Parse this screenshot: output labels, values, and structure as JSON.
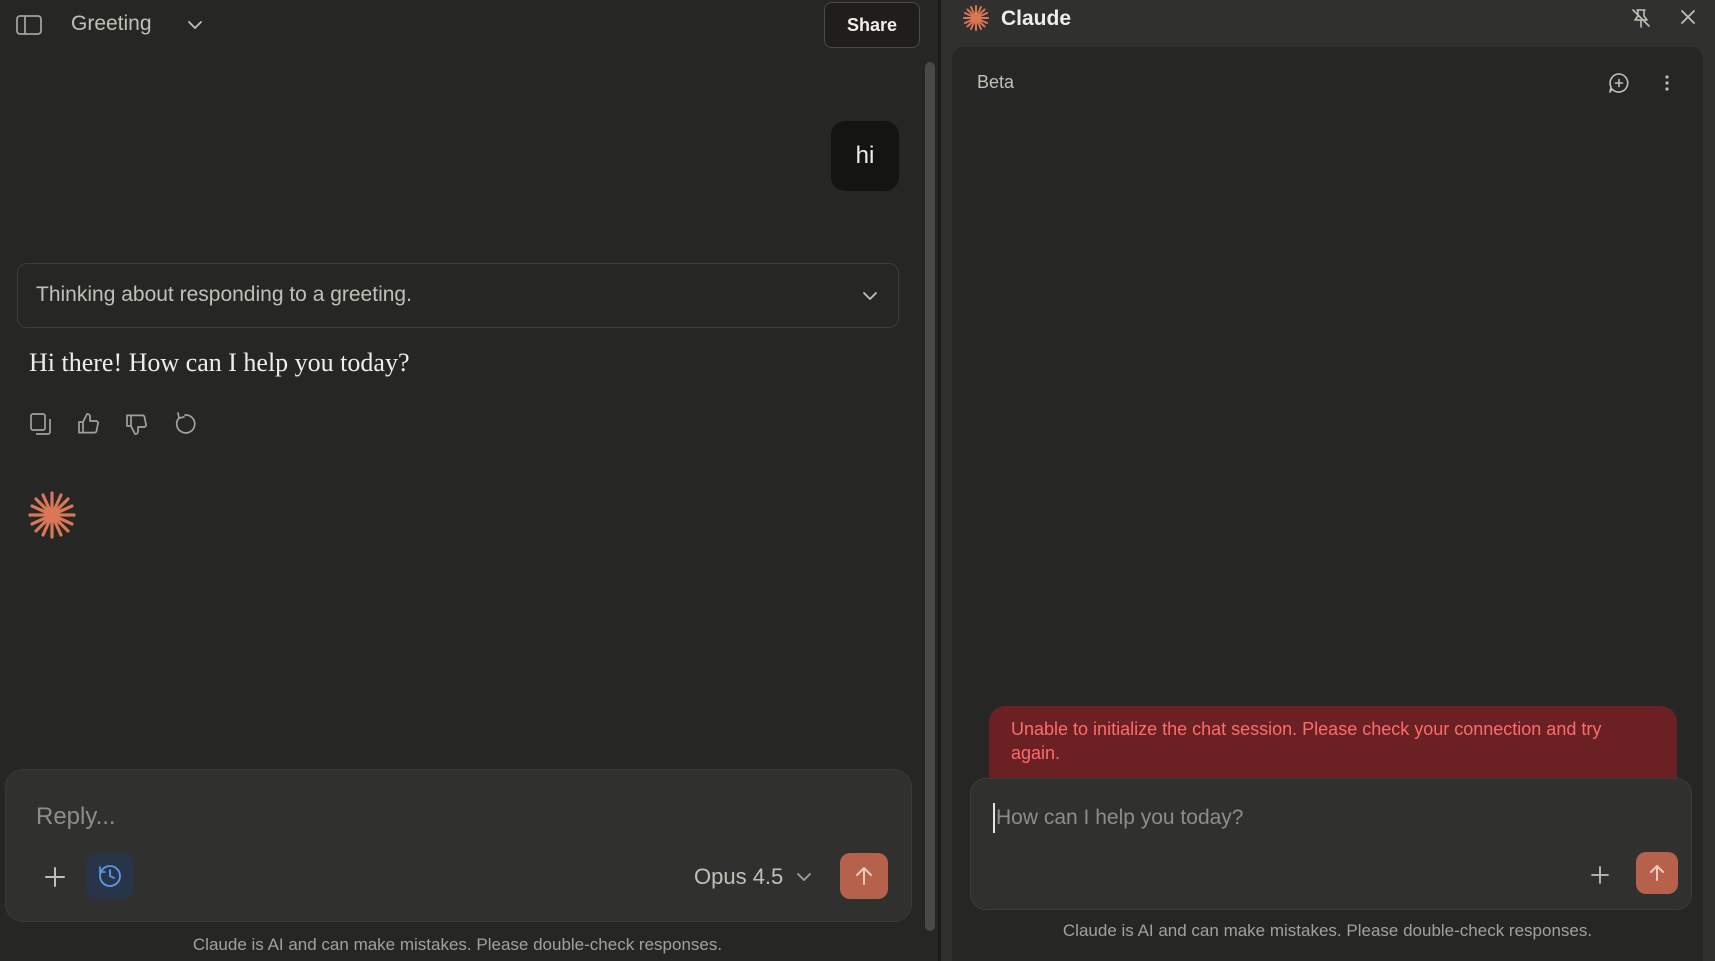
{
  "colors": {
    "accent": "#d97757",
    "send_button": "#b5614b",
    "error_text": "#ff6b6b",
    "error_bg": "#6b2124",
    "clock_bg": "#283447"
  },
  "main": {
    "header": {
      "sidebar_icon": "sidebar-toggle-icon",
      "title": "Greeting",
      "share_label": "Share"
    },
    "messages": {
      "user_text": "hi",
      "thinking_summary": "Thinking about responding to a greeting.",
      "assistant_text": "Hi there! How can I help you today?",
      "actions": [
        "copy-icon",
        "thumbs-up-icon",
        "thumbs-down-icon",
        "retry-icon"
      ]
    },
    "composer": {
      "placeholder": "Reply...",
      "model": "Opus 4.5"
    },
    "disclaimer": "Claude is AI and can make mistakes. Please double-check responses."
  },
  "side_panel": {
    "title": "Claude",
    "beta_label": "Beta",
    "error_message": "Unable to initialize the chat session. Please check your connection and try again.",
    "composer": {
      "placeholder": "How can I help you today?"
    },
    "disclaimer": "Claude is AI and can make mistakes. Please double-check responses."
  }
}
